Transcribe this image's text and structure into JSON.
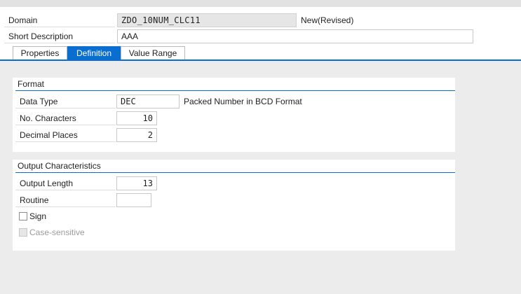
{
  "header": {
    "domain_label": "Domain",
    "domain_value": "ZDO_10NUM_CLC11",
    "domain_status": "New(Revised)",
    "short_desc_label": "Short Description",
    "short_desc_value": "AAA"
  },
  "tabs": [
    {
      "label": "Properties",
      "active": false
    },
    {
      "label": "Definition",
      "active": true
    },
    {
      "label": "Value Range",
      "active": false
    }
  ],
  "format": {
    "title": "Format",
    "data_type_label": "Data Type",
    "data_type_value": "DEC",
    "data_type_desc": "Packed Number in BCD Format",
    "no_chars_label": "No. Characters",
    "no_chars_value": "10",
    "decimal_label": "Decimal Places",
    "decimal_value": "2"
  },
  "output": {
    "title": "Output Characteristics",
    "output_length_label": "Output Length",
    "output_length_value": "13",
    "routine_label": "Routine",
    "routine_value": "",
    "sign_label": "Sign",
    "sign_checked": false,
    "case_label": "Case-sensitive",
    "case_checked": false
  },
  "colors": {
    "accent": "#0a6ed1",
    "background": "#ececec",
    "readonly_field": "#e6e6e6"
  }
}
